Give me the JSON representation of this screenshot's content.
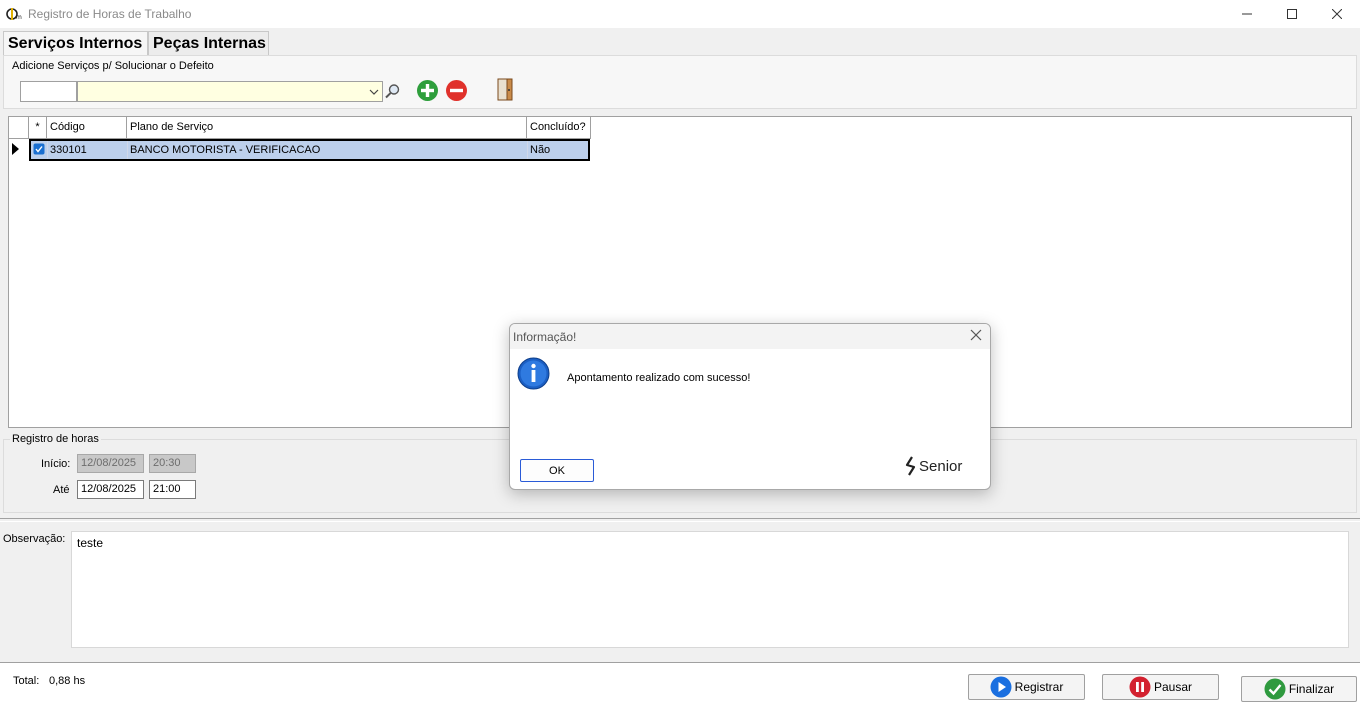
{
  "window": {
    "title": "Registro de Horas de Trabalho"
  },
  "tabs": [
    {
      "label": "Serviços Internos",
      "active": true
    },
    {
      "label": "Peças Internas",
      "active": false
    }
  ],
  "add_services": {
    "legend": "Adicione Serviços p/ Solucionar o Defeito",
    "code_value": "",
    "combo_value": ""
  },
  "grid": {
    "columns": [
      "*",
      "Código",
      "Plano de Serviço",
      "Concluído?"
    ],
    "rows": [
      {
        "checked": true,
        "codigo": "330101",
        "plano": "BANCO MOTORISTA - VERIFICACAO",
        "concluido": "Não"
      }
    ]
  },
  "hours": {
    "legend": "Registro de horas",
    "inicio_label": "Início:",
    "inicio_date": "12/08/2025",
    "inicio_time": "20:30",
    "ate_label": "Até",
    "ate_date": "12/08/2025",
    "ate_time": "21:00"
  },
  "observacao": {
    "label": "Observação:",
    "value": "teste"
  },
  "footer": {
    "total_label": "Total:",
    "total_value": "0,88 hs",
    "registrar_label": "Registrar",
    "pausar_label": "Pausar",
    "finalizar_label": "Finalizar"
  },
  "dialog": {
    "title": "Informação!",
    "message": "Apontamento realizado com sucesso!",
    "ok_label": "OK",
    "brand": "Senior"
  },
  "colors": {
    "selected_row": "#bdd0ec",
    "combo_bg": "#ffffe1",
    "add_green": "#2e9e3c",
    "remove_red": "#e0312b",
    "registrar_blue": "#1a6fe0",
    "pausar_red": "#d3212f",
    "finalizar_green": "#2f9a3f"
  }
}
